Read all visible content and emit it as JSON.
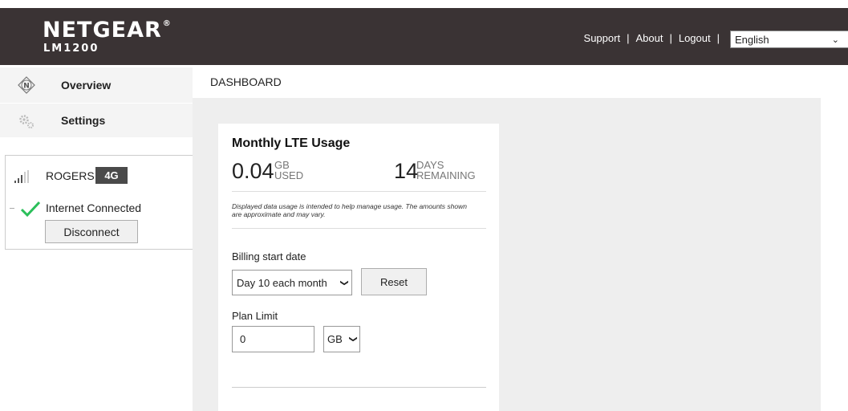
{
  "header": {
    "brand": "NETGEAR",
    "model": "LM1200",
    "links": [
      "Support",
      "About",
      "Logout"
    ],
    "language": "English"
  },
  "sidebar": {
    "items": [
      {
        "label": "Overview",
        "icon": "netgear-n-icon"
      },
      {
        "label": "Settings",
        "icon": "gears-icon"
      }
    ],
    "status": {
      "carrier": "ROGERS",
      "network": "4G",
      "connection": "Internet Connected",
      "disconnect_label": "Disconnect"
    }
  },
  "main": {
    "tab": "DASHBOARD",
    "card": {
      "title": "Monthly LTE Usage",
      "usage_value": "0.04",
      "usage_unit_top": "GB",
      "usage_unit_bottom": "USED",
      "days_value": "14",
      "days_unit_top": "DAYS",
      "days_unit_bottom": "REMAINING",
      "disclaimer": "Displayed data usage is intended to help manage usage. The amounts shown are approximate and may vary.",
      "billing_label": "Billing start date",
      "billing_value": "Day 10 each month",
      "reset_label": "Reset",
      "plan_label": "Plan Limit",
      "plan_value": "0",
      "plan_unit": "GB"
    }
  },
  "colors": {
    "header_bg": "#3a3334",
    "check_green": "#2bbf5a",
    "badge_bg": "#4a4a4a",
    "content_bg": "#eeeeee"
  }
}
